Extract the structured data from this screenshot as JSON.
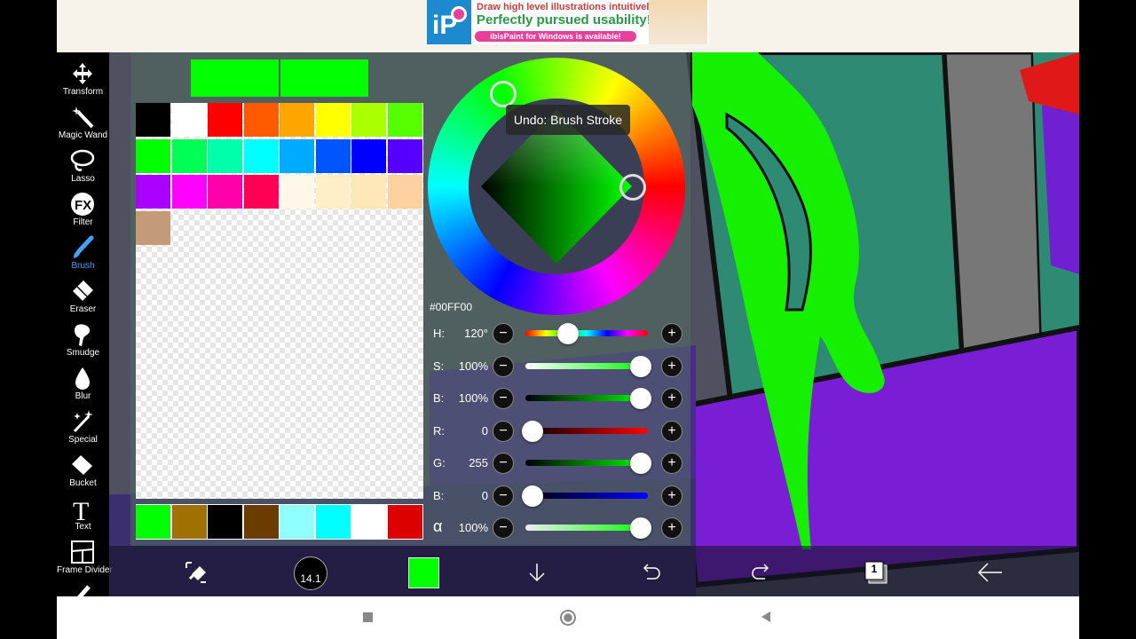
{
  "ad": {
    "line1": "Draw high level illustrations intuitively!",
    "line2": "Perfectly pursued usability!",
    "line3": "ibisPaint for Windows is available!"
  },
  "toolbar": {
    "items": [
      {
        "label": "Transform",
        "icon": "transform-icon"
      },
      {
        "label": "Magic Wand",
        "icon": "magic-wand-icon"
      },
      {
        "label": "Lasso",
        "icon": "lasso-icon"
      },
      {
        "label": "Filter",
        "icon": "fx-icon"
      },
      {
        "label": "Brush",
        "icon": "brush-icon",
        "active": true
      },
      {
        "label": "Eraser",
        "icon": "eraser-icon"
      },
      {
        "label": "Smudge",
        "icon": "smudge-icon"
      },
      {
        "label": "Blur",
        "icon": "blur-drop-icon"
      },
      {
        "label": "Special",
        "icon": "special-sparkle-icon"
      },
      {
        "label": "Bucket",
        "icon": "bucket-icon"
      },
      {
        "label": "Text",
        "icon": "text-icon"
      },
      {
        "label": "Frame Divider",
        "icon": "frame-divider-icon"
      }
    ]
  },
  "color_panel": {
    "current_color": "#00ff00",
    "previous_color": "#00ff00",
    "palette": [
      "#000000",
      "#ffffff",
      "#ff0000",
      "#ff5a00",
      "#ffa500",
      "#ffff00",
      "#aaff00",
      "#55ff00",
      "#00ff00",
      "#00ff55",
      "#00ffaa",
      "#00ffff",
      "#00aaff",
      "#0055ff",
      "#0000ff",
      "#5500ff",
      "#aa00ff",
      "#ff00ff",
      "#ff00aa",
      "#ff0055",
      "#fff8e8",
      "#ffefc8",
      "#ffe8b8",
      "#ffd0a0",
      "#c49a78"
    ],
    "history": [
      "#00ff00",
      "#a07000",
      "#000000",
      "#6a3c00",
      "#90ffff",
      "#00ffff",
      "#ffffff",
      "#dd0000"
    ],
    "hex": "#00FF00",
    "tooltip": "Undo: Brush Stroke",
    "sliders": [
      {
        "label": "H:",
        "value": "120°",
        "fraction": 0.33
      },
      {
        "label": "S:",
        "value": "100%",
        "fraction": 1.0
      },
      {
        "label": "B:",
        "value": "100%",
        "fraction": 1.0
      },
      {
        "label": "R:",
        "value": "0",
        "fraction": 0.0
      },
      {
        "label": "G:",
        "value": "255",
        "fraction": 1.0
      },
      {
        "label": "B:",
        "value": "0",
        "fraction": 0.0
      },
      {
        "label": "α",
        "value": "100%",
        "fraction": 1.0
      }
    ]
  },
  "bottom_bar": {
    "brush_size": "14.1",
    "layer_count": "1"
  }
}
